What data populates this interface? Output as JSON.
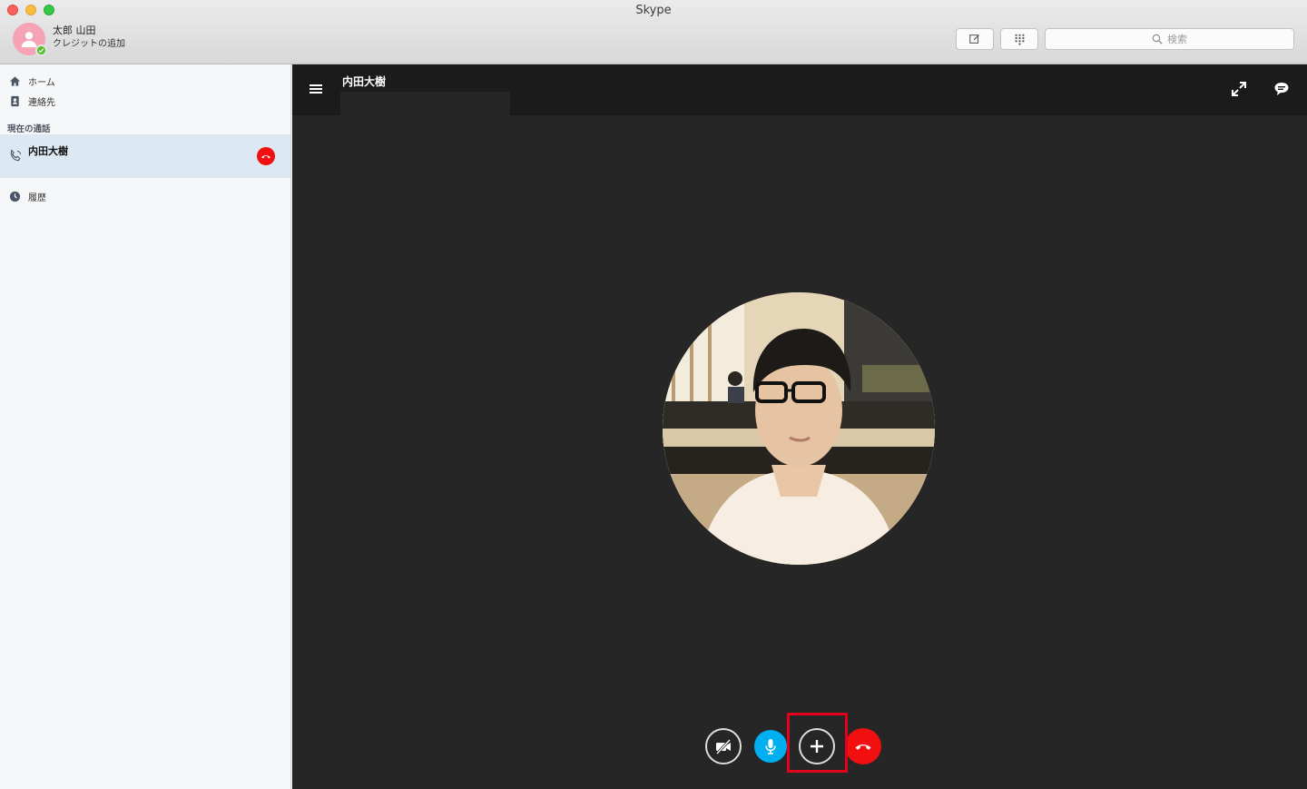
{
  "window": {
    "title": "Skype"
  },
  "profile": {
    "name": "太郎 山田",
    "credit_link": "クレジットの追加",
    "presence_color": "#4fbf26",
    "avatar_color": "#f5a3b5"
  },
  "toolbar": {
    "compose_icon": "compose-icon",
    "dialpad_icon": "dialpad-icon",
    "search_placeholder": "検索"
  },
  "sidebar": {
    "nav": [
      {
        "label": "ホーム",
        "icon": "home-icon"
      },
      {
        "label": "連絡先",
        "icon": "contacts-icon"
      }
    ],
    "current_calls_label": "現在の通話",
    "active_call": {
      "name": "内田大樹",
      "icon": "phone-icon",
      "end_icon": "hang-up-icon",
      "end_color": "#f20f0f"
    },
    "history": {
      "label": "履歴",
      "icon": "clock-icon"
    }
  },
  "call": {
    "contact_name": "内田大樹",
    "header_icons": [
      "menu-icon",
      "fullscreen-icon",
      "chat-icon"
    ],
    "controls": [
      {
        "name": "video-off",
        "icon": "video-off-icon"
      },
      {
        "name": "microphone",
        "icon": "microphone-icon",
        "color": "#00aff0"
      },
      {
        "name": "add-participant",
        "icon": "plus-icon",
        "highlighted": true,
        "highlight_color": "#e2001a"
      },
      {
        "name": "end-call",
        "icon": "hang-up-icon",
        "color": "#f20f0f"
      }
    ]
  }
}
